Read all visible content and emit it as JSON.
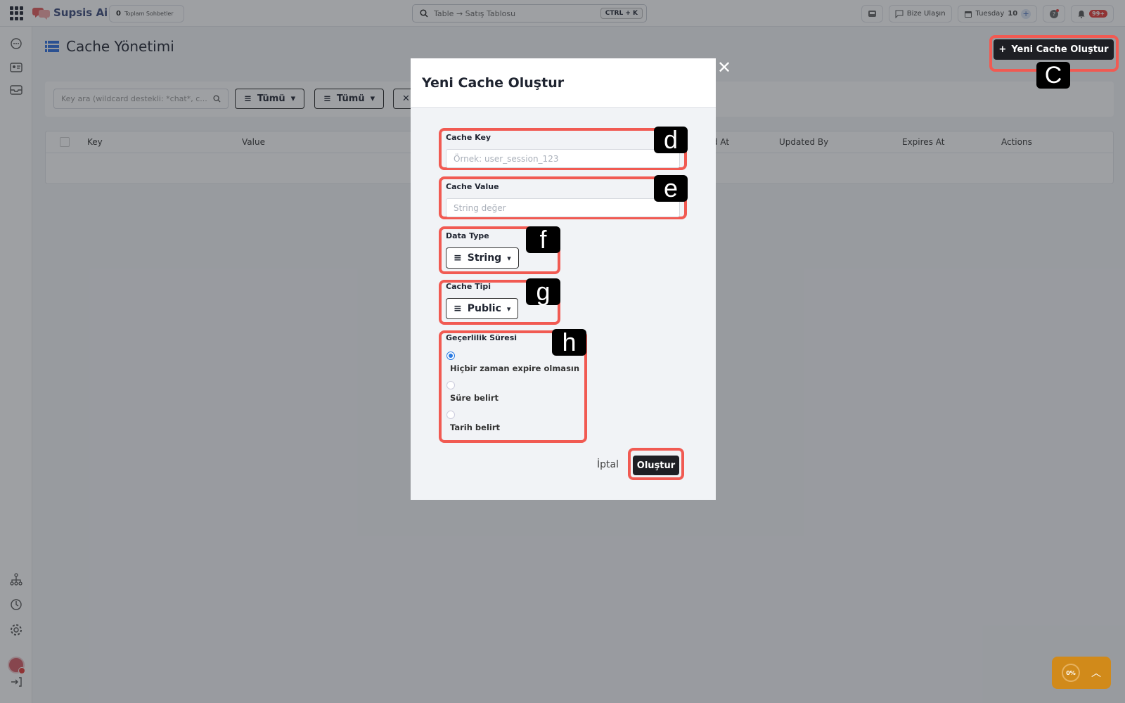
{
  "app": {
    "name": "Supsis Ai",
    "chat_count": "0",
    "chat_count_label": "Toplam Sohbetler",
    "search_placeholder": "Table → Satış Tablosu",
    "search_shortcut": "CTRL + K",
    "contact_label": "Bize Ulaşın",
    "date_day": "Tuesday",
    "date_num": "10",
    "notif_badge": "99+"
  },
  "page": {
    "title": "Cache Yönetimi",
    "new_button": "Yeni Cache Oluştur",
    "key_search_placeholder": "Key ara (wildcard destekli: *chat*, c...",
    "filter1": "Tümü",
    "filter2": "Tümü"
  },
  "table": {
    "headers": [
      "Key",
      "Value",
      "d At",
      "Updated By",
      "Expires At",
      "Actions"
    ]
  },
  "modal": {
    "title": "Yeni Cache Oluştur",
    "cache_key_label": "Cache Key",
    "cache_key_placeholder": "Örnek: user_session_123",
    "cache_value_label": "Cache Value",
    "cache_value_placeholder": "String değer",
    "data_type_label": "Data Type",
    "data_type_value": "String",
    "cache_type_label": "Cache Tipi",
    "cache_type_value": "Public",
    "validity_label": "Geçerlilik Süresi",
    "options": [
      "Hiçbir zaman expire olmasın",
      "Süre belirt",
      "Tarih belirt"
    ],
    "selected_option_index": 0,
    "cancel": "İptal",
    "submit": "Oluştur"
  },
  "annotations": {
    "c": "C",
    "d": "d",
    "e": "e",
    "f": "f",
    "g": "g",
    "h": "h"
  },
  "progress": {
    "value": "0%"
  },
  "colors": {
    "highlight": "#f15a52",
    "primary_dark": "#1e1f24",
    "radio_blue": "#2a7ae2",
    "fab_orange": "#d18a1a"
  }
}
